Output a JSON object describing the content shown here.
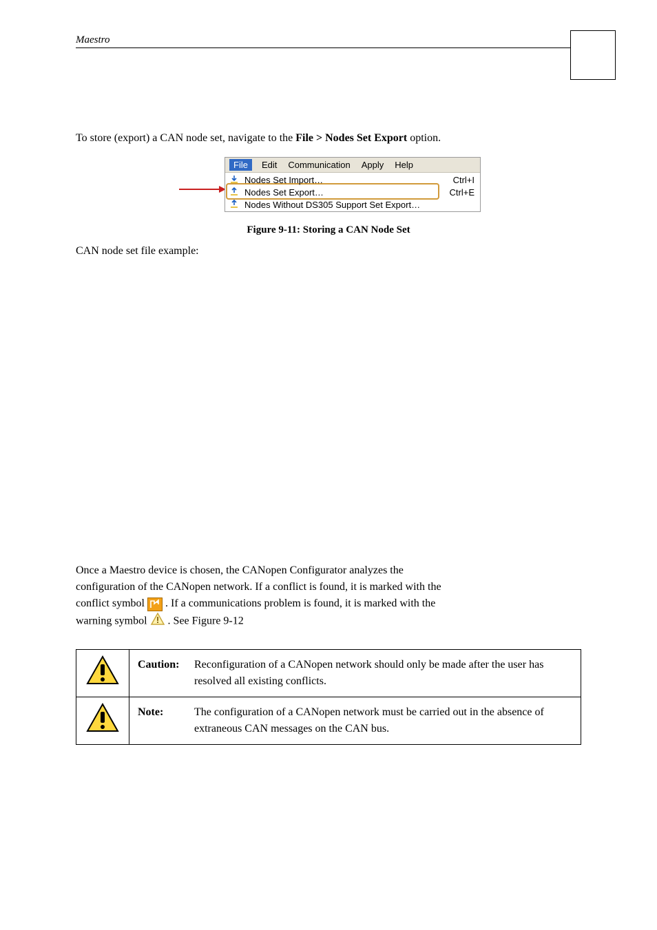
{
  "header": {
    "title": "Maestro"
  },
  "intro": {
    "pre": "To store (export) a CAN node set, navigate to the ",
    "bold": "File > Nodes Set Export",
    "post": " option."
  },
  "menu": {
    "titlebar": {
      "file": "File",
      "edit": "Edit",
      "comm": "Communication",
      "apply": "Apply",
      "help": "Help"
    },
    "items": [
      {
        "label": "Nodes Set Import…",
        "shortcut": "Ctrl+I"
      },
      {
        "label": "Nodes Set Export…",
        "shortcut": "Ctrl+E"
      },
      {
        "label": "Nodes Without DS305 Support Set Export…"
      }
    ]
  },
  "figure_caption": "Figure 9-11: Storing a CAN Node Set",
  "example_line": "CAN node set file example:",
  "para2": {
    "l1": "Once a Maestro device is chosen, the CANopen Configurator analyzes the",
    "l2": "configuration of the CANopen network. If a conflict is found, it is marked with the",
    "l3a": "conflict symbol ",
    "l3b": " . If a communications problem is found, it is marked with the",
    "l4a": "warning symbol ",
    "l4b": " . See Figure 9-12"
  },
  "caution": {
    "label": "Caution:",
    "text": "Reconfiguration of a CANopen network should only be made after the user has resolved all existing conflicts."
  },
  "note": {
    "label": "Note:",
    "text": "The configuration of a CANopen network must be carried out in the absence of extraneous CAN messages on the CAN bus."
  }
}
